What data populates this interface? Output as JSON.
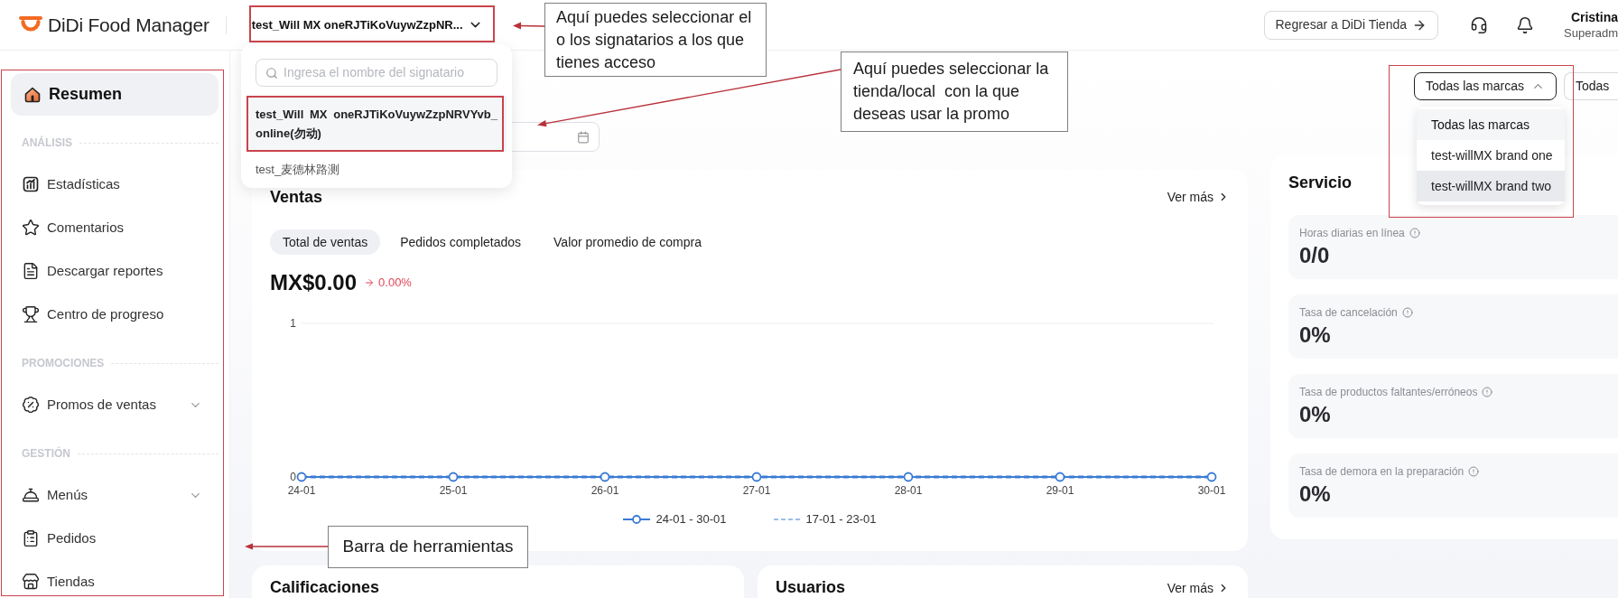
{
  "header": {
    "logo": "DiDi Food Manager",
    "signatory_selector": "test_Will MX oneRJTiKoVuywZzpNR...",
    "return_button": "Regresar a DiDi Tienda",
    "user": {
      "name": "Cristina",
      "role": "Superadm"
    }
  },
  "signatory_dropdown": {
    "placeholder": "Ingresa el nombre del signatario",
    "options": [
      {
        "label": "test_Will MX oneRJTiKoVuywZzpNRVYvb_online(勿动)",
        "selected": true
      },
      {
        "label": "test_麦德林路测",
        "selected": false
      }
    ]
  },
  "sidebar": {
    "items": [
      {
        "kind": "link",
        "label": "Resumen",
        "selected": true
      },
      {
        "kind": "section",
        "label": "ANÁLISIS"
      },
      {
        "kind": "link",
        "label": "Estadísticas",
        "selected": false
      },
      {
        "kind": "link",
        "label": "Comentarios",
        "selected": false
      },
      {
        "kind": "link",
        "label": "Descargar reportes",
        "selected": false
      },
      {
        "kind": "link",
        "label": "Centro de progreso",
        "selected": false
      },
      {
        "kind": "section",
        "label": "PROMOCIONES"
      },
      {
        "kind": "link",
        "label": "Promos de ventas",
        "selected": false,
        "expanded": false
      },
      {
        "kind": "section",
        "label": "GESTIÓN"
      },
      {
        "kind": "link",
        "label": "Menús",
        "selected": false,
        "expanded": false
      },
      {
        "kind": "link",
        "label": "Pedidos",
        "selected": false
      },
      {
        "kind": "link",
        "label": "Tiendas",
        "selected": false
      }
    ]
  },
  "brand_filter": {
    "buttons": [
      {
        "label": "Todas las marcas",
        "expanded": true
      },
      {
        "label": "Todas"
      }
    ],
    "options": [
      {
        "label": "Todas las marcas",
        "selected": true,
        "hovered": false
      },
      {
        "label": "test-willMX brand one",
        "selected": false,
        "hovered": false
      },
      {
        "label": "test-willMX brand two",
        "selected": false,
        "hovered": true
      }
    ]
  },
  "sales": {
    "title": "Ventas",
    "more_link": "Ver más",
    "tabs": [
      {
        "label": "Total de ventas",
        "selected": true
      },
      {
        "label": "Pedidos completados",
        "selected": false
      },
      {
        "label": "Valor promedio de compra",
        "selected": false
      }
    ],
    "amount": "MX$0.00",
    "change": "0.00%",
    "chart_data": {
      "type": "line",
      "categories": [
        "24-01",
        "25-01",
        "26-01",
        "27-01",
        "28-01",
        "29-01",
        "30-01"
      ],
      "series": [
        {
          "name": "24-01 - 30-01",
          "color": "#3a7bd5",
          "line_style": "solid",
          "marker": "circle",
          "values": [
            0,
            0,
            0,
            0,
            0,
            0,
            0
          ]
        },
        {
          "name": "17-01 - 23-01",
          "color": "#9dbdea",
          "line_style": "dashed",
          "values": [
            0,
            0,
            0,
            0,
            0,
            0,
            0
          ]
        }
      ],
      "ylim": [
        0,
        1
      ],
      "yticks": [
        0,
        1
      ],
      "legend": "bottom"
    }
  },
  "bottom_cards": [
    {
      "title": "Calificaciones"
    },
    {
      "title": "Usuarios",
      "more_link": "Ver más"
    }
  ],
  "service": {
    "title": "Servicio",
    "metrics": [
      {
        "label": "Horas diarias en línea",
        "value": "0/0"
      },
      {
        "label": "Tasa de cancelación",
        "value": "0%"
      },
      {
        "label": "Tasa de productos faltantes/erróneos",
        "value": "0%"
      },
      {
        "label": "Tasa de demora en la preparación",
        "value": "0%"
      }
    ]
  },
  "annotations": [
    {
      "text": "Aquí puedes seleccionar el o los signatarios a los que tienes acceso"
    },
    {
      "text": "Aquí puedes seleccionar la tienda/local  con la que deseas usar la promo"
    },
    {
      "text": "Barra de herramientas"
    }
  ]
}
